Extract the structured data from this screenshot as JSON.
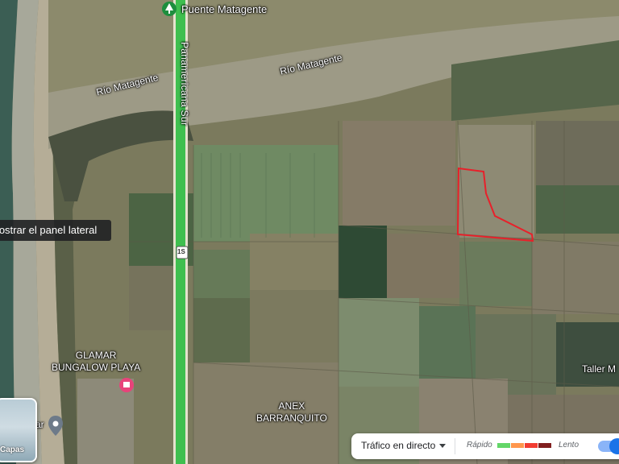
{
  "map": {
    "labels": {
      "bridge": "Puente Matagente",
      "river_west": "Río Matagente",
      "river_east": "Río Matagente",
      "highway": "Panamericana Sur",
      "highway_shield": "1S",
      "beach_poi": "GLAMAR\nBUNGALOW PLAYA",
      "village": "ANEX\nBARRANQUITO",
      "partial_east": "Taller M",
      "partial_west": "ar"
    },
    "icons": {
      "bridge": "tree-icon",
      "beach_poi": "hotel-pin-icon",
      "west_pin": "location-pin-icon"
    },
    "colors": {
      "road": "#3fbf4f",
      "parcel_outline": "#e8202a",
      "poi_pink": "#e8437a",
      "pin_gray": "#6d7a89"
    }
  },
  "sidebar_tooltip": "Mostrar el panel lateral",
  "layers_button": {
    "label": "Capas"
  },
  "traffic": {
    "title": "Tráfico en directo",
    "fast_label": "Rápido",
    "slow_label": "Lento",
    "legend_colors": [
      "#63d668",
      "#ff974d",
      "#f23c32",
      "#811f1f"
    ]
  }
}
